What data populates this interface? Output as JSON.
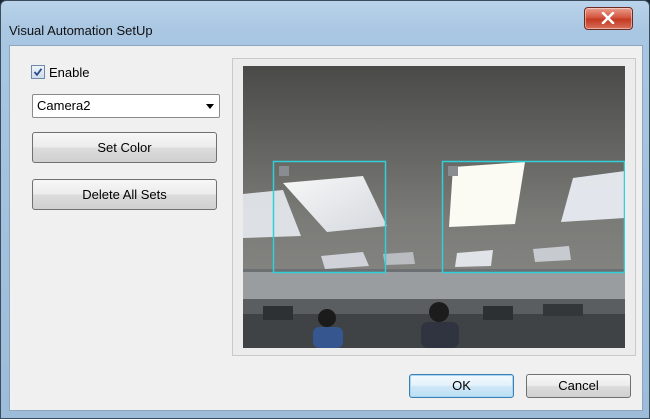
{
  "window": {
    "title": "Visual Automation SetUp",
    "close_icon": "close-x-icon",
    "close_color": "#c43a22"
  },
  "controls": {
    "enable": {
      "label": "Enable",
      "checked": true
    },
    "camera_select": {
      "value": "Camera2"
    },
    "set_color_label": "Set Color",
    "delete_all_label": "Delete All Sets"
  },
  "preview": {
    "description_icon": "camera-preview",
    "regions": [
      {
        "name": "region-1",
        "color": "#2fd0d8"
      },
      {
        "name": "region-2",
        "color": "#2fd0d8"
      }
    ]
  },
  "footer": {
    "ok_label": "OK",
    "cancel_label": "Cancel"
  }
}
